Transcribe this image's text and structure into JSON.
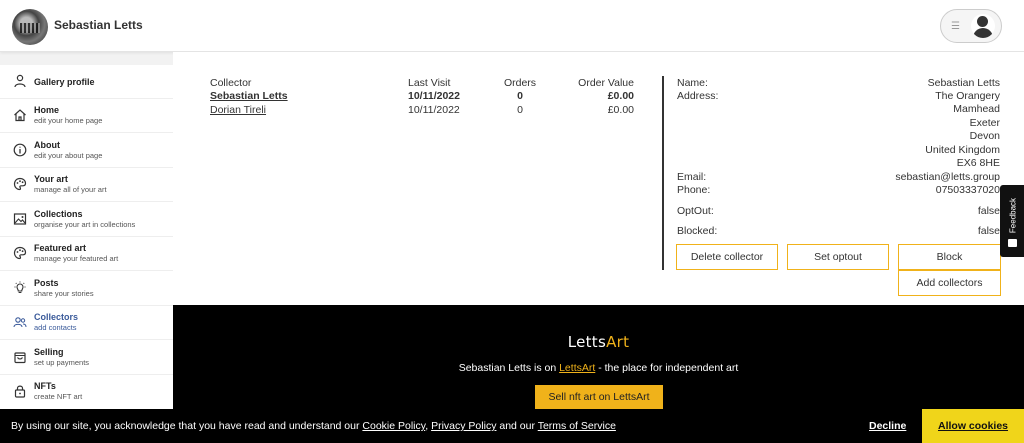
{
  "header": {
    "gallery_name": "Sebastian Letts"
  },
  "sidebar": {
    "items": [
      {
        "label": "Gallery profile",
        "sub": "",
        "icon": "person-icon"
      },
      {
        "label": "Home",
        "sub": "edit your home page",
        "icon": "home-icon"
      },
      {
        "label": "About",
        "sub": "edit your about page",
        "icon": "info-icon"
      },
      {
        "label": "Your art",
        "sub": "manage all of your art",
        "icon": "palette-icon"
      },
      {
        "label": "Collections",
        "sub": "organise your art in collections",
        "icon": "image-icon"
      },
      {
        "label": "Featured art",
        "sub": "manage your featured art",
        "icon": "palette-icon"
      },
      {
        "label": "Posts",
        "sub": "share your stories",
        "icon": "lightbulb-icon"
      },
      {
        "label": "Collectors",
        "sub": "add contacts",
        "icon": "people-icon"
      },
      {
        "label": "Selling",
        "sub": "set up payments",
        "icon": "shopping-bag-icon"
      },
      {
        "label": "NFTs",
        "sub": "create NFT art",
        "icon": "lock-icon"
      }
    ],
    "active_index": 7,
    "accent_color": "#3a5a9a"
  },
  "collectors_table": {
    "headers": {
      "collector": "Collector",
      "last_visit": "Last Visit",
      "orders": "Orders",
      "order_value": "Order Value"
    },
    "rows": [
      {
        "collector": "Sebastian Letts",
        "last_visit": "10/11/2022",
        "orders": "0",
        "order_value": "£0.00",
        "selected": true
      },
      {
        "collector": "Dorian Tireli",
        "last_visit": "10/11/2022",
        "orders": "0",
        "order_value": "£0.00",
        "selected": false
      }
    ]
  },
  "details": {
    "name_label": "Name:",
    "name": "Sebastian Letts",
    "address_label": "Address:",
    "address_lines": [
      "The Orangery",
      "Mamhead",
      "Exeter",
      "Devon",
      "United Kingdom",
      "EX6 8HE"
    ],
    "email_label": "Email:",
    "email": "sebastian@letts.group",
    "phone_label": "Phone:",
    "phone": "07503337020",
    "optout_label": "OptOut:",
    "optout": "false",
    "blocked_label": "Blocked:",
    "blocked": "false"
  },
  "actions": {
    "delete": "Delete collector",
    "optout": "Set optout",
    "block": "Block",
    "add": "Add collectors"
  },
  "feedback": {
    "label": "Feedback"
  },
  "footer": {
    "logo_main": "Letts",
    "logo_accent": "Art",
    "line_prefix": "Sebastian Letts is on ",
    "line_link": "LettsArt",
    "line_suffix": " - the place for independent art",
    "sell_button": "Sell nft art on LettsArt"
  },
  "cookie": {
    "text_prefix": "By using our site, you acknowledge that you have read and understand our ",
    "cookie_policy": "Cookie Policy",
    "sep": ", ",
    "privacy_policy": "Privacy Policy",
    "and_our": " and our ",
    "terms": "Terms of Service",
    "decline": "Decline",
    "allow": "Allow cookies"
  },
  "colors": {
    "accent": "#f0b21a",
    "allow_button": "#f0d51a",
    "footer_bg": "#000000"
  }
}
